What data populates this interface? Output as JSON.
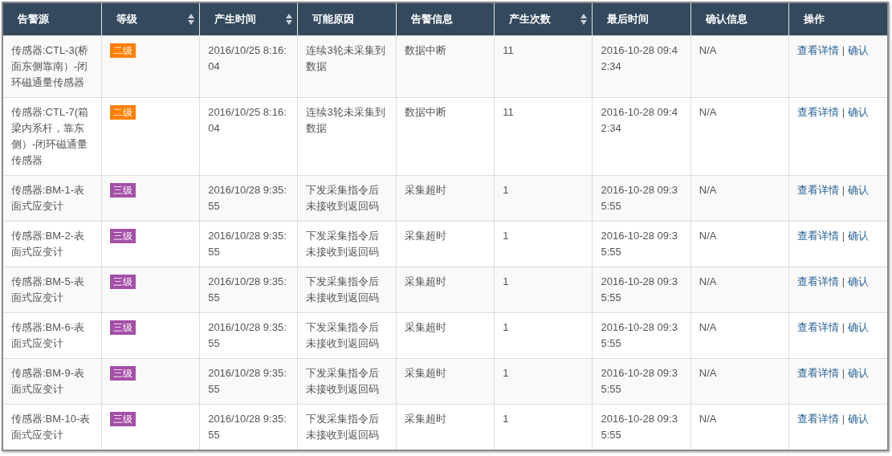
{
  "table": {
    "columns": [
      {
        "label": "告警源",
        "sortable": false
      },
      {
        "label": "等级",
        "sortable": true
      },
      {
        "label": "产生时间",
        "sortable": true
      },
      {
        "label": "可能原因",
        "sortable": false
      },
      {
        "label": "告警信息",
        "sortable": false
      },
      {
        "label": "产生次数",
        "sortable": true
      },
      {
        "label": "最后时间",
        "sortable": false
      },
      {
        "label": "确认信息",
        "sortable": false
      },
      {
        "label": "操作",
        "sortable": false
      }
    ],
    "rows": [
      {
        "source": "传感器:CTL-3(桥面东侧靠南）-闭环磁通量传感器",
        "level": {
          "text": "二级",
          "color": "#ff7f00"
        },
        "time": "2016/10/25 8:16:04",
        "cause": "连续3轮未采集到数据",
        "info": "数据中断",
        "count": "11",
        "last_time": "2016-10-28 09:42:34",
        "confirm": "N/A",
        "actions": {
          "detail": "查看详情",
          "separator": "|",
          "confirm": "确认"
        }
      },
      {
        "source": "传感器:CTL-7(箱梁内系杆，靠东侧）-闭环磁通量传感器",
        "level": {
          "text": "二级",
          "color": "#ff7f00"
        },
        "time": "2016/10/25 8:16:04",
        "cause": "连续3轮未采集到数据",
        "info": "数据中断",
        "count": "11",
        "last_time": "2016-10-28 09:42:34",
        "confirm": "N/A",
        "actions": {
          "detail": "查看详情",
          "separator": "|",
          "confirm": "确认"
        }
      },
      {
        "source": "传感器:BM-1-表面式应变计",
        "level": {
          "text": "三级",
          "color": "#a54fa8"
        },
        "time": "2016/10/28 9:35:55",
        "cause": "下发采集指令后未接收到返回码",
        "info": "采集超时",
        "count": "1",
        "last_time": "2016-10-28 09:35:55",
        "confirm": "N/A",
        "actions": {
          "detail": "查看详情",
          "separator": "|",
          "confirm": "确认"
        }
      },
      {
        "source": "传感器:BM-2-表面式应变计",
        "level": {
          "text": "三级",
          "color": "#a54fa8"
        },
        "time": "2016/10/28 9:35:55",
        "cause": "下发采集指令后未接收到返回码",
        "info": "采集超时",
        "count": "1",
        "last_time": "2016-10-28 09:35:55",
        "confirm": "N/A",
        "actions": {
          "detail": "查看详情",
          "separator": "|",
          "confirm": "确认"
        }
      },
      {
        "source": "传感器:BM-5-表面式应变计",
        "level": {
          "text": "三级",
          "color": "#a54fa8"
        },
        "time": "2016/10/28 9:35:55",
        "cause": "下发采集指令后未接收到返回码",
        "info": "采集超时",
        "count": "1",
        "last_time": "2016-10-28 09:35:55",
        "confirm": "N/A",
        "actions": {
          "detail": "查看详情",
          "separator": "|",
          "confirm": "确认"
        }
      },
      {
        "source": "传感器:BM-6-表面式应变计",
        "level": {
          "text": "三级",
          "color": "#a54fa8"
        },
        "time": "2016/10/28 9:35:55",
        "cause": "下发采集指令后未接收到返回码",
        "info": "采集超时",
        "count": "1",
        "last_time": "2016-10-28 09:35:55",
        "confirm": "N/A",
        "actions": {
          "detail": "查看详情",
          "separator": "|",
          "confirm": "确认"
        }
      },
      {
        "source": "传感器:BM-9-表面式应变计",
        "level": {
          "text": "三级",
          "color": "#a54fa8"
        },
        "time": "2016/10/28 9:35:55",
        "cause": "下发采集指令后未接收到返回码",
        "info": "采集超时",
        "count": "1",
        "last_time": "2016-10-28 09:35:55",
        "confirm": "N/A",
        "actions": {
          "detail": "查看详情",
          "separator": "|",
          "confirm": "确认"
        }
      },
      {
        "source": "传感器:BM-10-表面式应变计",
        "level": {
          "text": "三级",
          "color": "#a54fa8"
        },
        "time": "2016/10/28 9:35:55",
        "cause": "下发采集指令后未接收到返回码",
        "info": "采集超时",
        "count": "1",
        "last_time": "2016-10-28 09:35:55",
        "confirm": "N/A",
        "actions": {
          "detail": "查看详情",
          "separator": "|",
          "confirm": "确认"
        }
      }
    ]
  }
}
